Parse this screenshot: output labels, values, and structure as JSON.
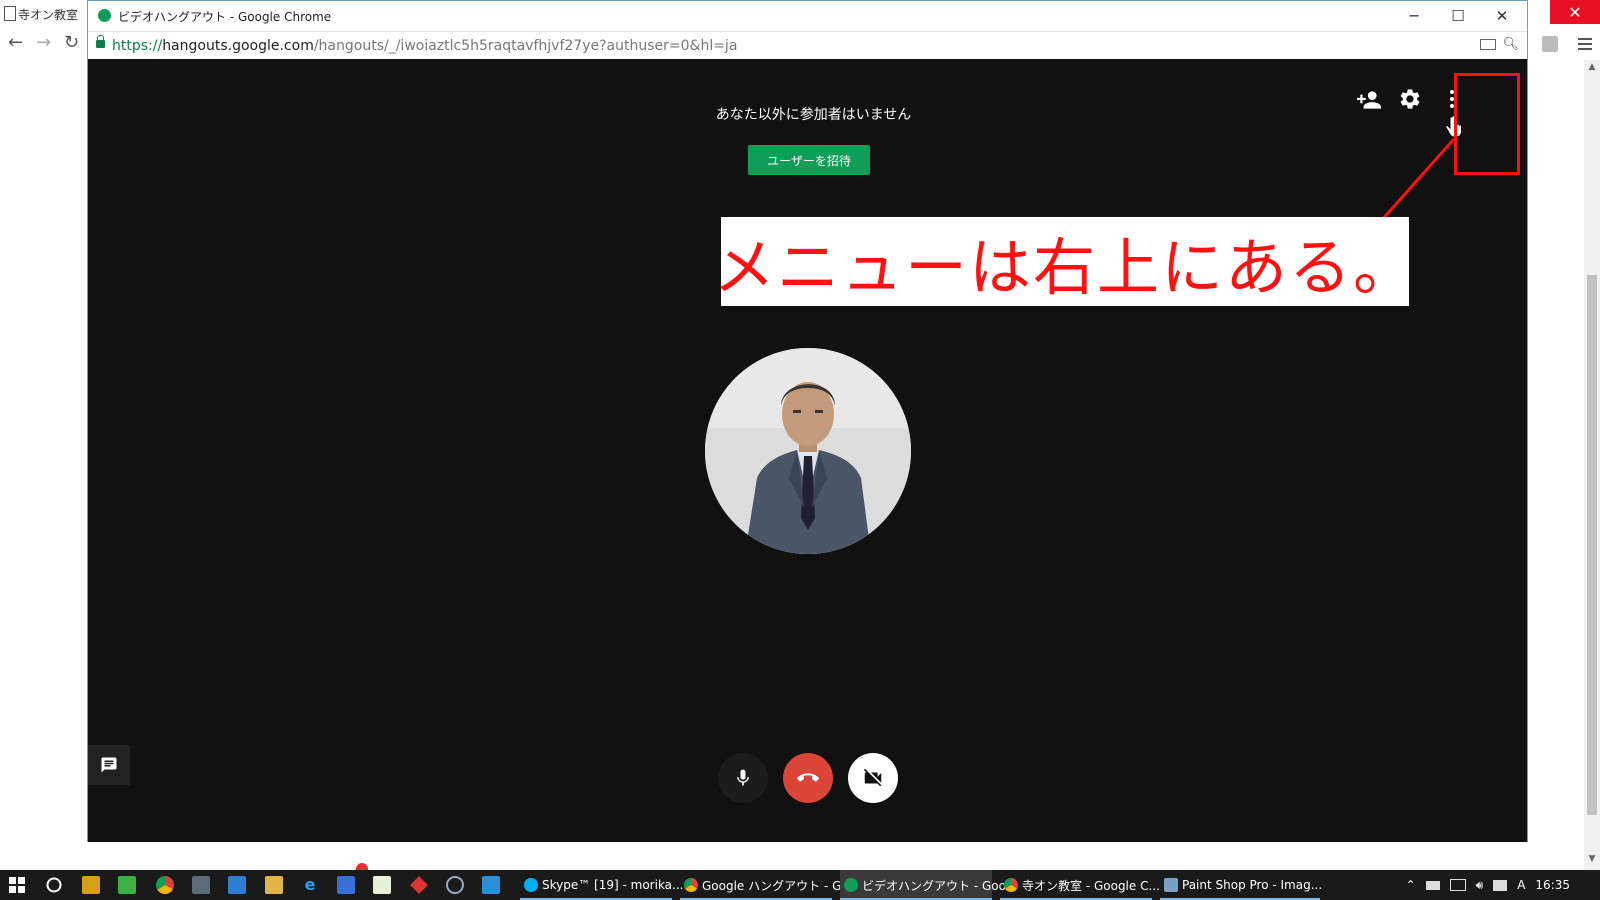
{
  "background_window": {
    "tab_title": "寺オン教室"
  },
  "popup": {
    "title": "ビデオハングアウト - Google Chrome",
    "url_scheme": "https://",
    "url_host": "hangouts.google.com",
    "url_path": "/hangouts/_/iwoiaztlc5h5raqtavfhjvf27ye?authuser=0&hl=ja",
    "window_controls": {
      "minimize": "─",
      "maximize": "☐",
      "close": "✕"
    }
  },
  "call": {
    "status_text": "あなた以外に参加者はいません",
    "invite_button": "ユーザーを招待",
    "annotation_text": "メニューは右上にある。"
  },
  "taskbar": {
    "tasks": [
      {
        "label": "Skype™ [19] - morika...",
        "icon": "skype-icon"
      },
      {
        "label": "Google ハングアウト - G...",
        "icon": "chrome-icon"
      },
      {
        "label": "ビデオハングアウト - Goo...",
        "icon": "hangouts-icon"
      },
      {
        "label": "寺オン教室 - Google C...",
        "icon": "chrome-icon"
      },
      {
        "label": "Paint Shop Pro - Imag...",
        "icon": "paintshop-icon"
      }
    ],
    "clock": "16:35",
    "ime_indicator": "A"
  },
  "colors": {
    "call_background": "#111111",
    "invite_green": "#0f9d58",
    "hangup_red": "#db4437",
    "annotation_red": "#ff1111"
  }
}
